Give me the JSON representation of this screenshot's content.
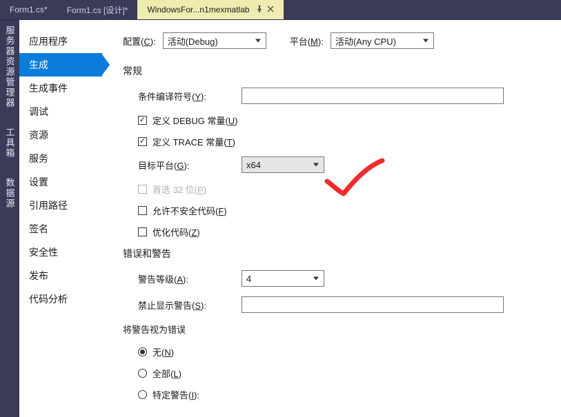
{
  "tabs": [
    {
      "label": "Form1.cs*"
    },
    {
      "label": "Form1.cs [设计]*"
    },
    {
      "label": "WindowsFor...n1mexmatlab"
    }
  ],
  "rail": {
    "items": [
      "服务器资源管理器",
      "工具箱",
      "数据源"
    ]
  },
  "sidebar": {
    "items": [
      "应用程序",
      "生成",
      "生成事件",
      "调试",
      "资源",
      "服务",
      "设置",
      "引用路径",
      "签名",
      "安全性",
      "发布",
      "代码分析"
    ],
    "selected": "生成"
  },
  "config": {
    "configLabelPrefix": "配置(",
    "configHotkey": "C",
    "configLabelSuffix": "):",
    "configValue": "活动(Debug)",
    "platformLabelPrefix": "平台(",
    "platformHotkey": "M",
    "platformLabelSuffix": "):",
    "platformValue": "活动(Any CPU)"
  },
  "general": {
    "header": "常规",
    "condSymbolsPrefix": "条件编译符号(",
    "condSymbolsHotkey": "Y",
    "condSymbolsSuffix": "):",
    "condSymbolsValue": "",
    "defineDebugPrefix": "定义 DEBUG 常量(",
    "defineDebugHotkey": "U",
    "defineDebugSuffix": ")",
    "defineTracePrefix": "定义 TRACE 常量(",
    "defineTraceHotkey": "T",
    "defineTraceSuffix": ")",
    "targetPlatformPrefix": "目标平台(",
    "targetPlatformHotkey": "G",
    "targetPlatformSuffix": "):",
    "targetPlatformValue": "x64",
    "prefer32Prefix": "首选 32 位(",
    "prefer32Hotkey": "P",
    "prefer32Suffix": ")",
    "allowUnsafePrefix": "允许不安全代码(",
    "allowUnsafeHotkey": "F",
    "allowUnsafeSuffix": ")",
    "optimizePrefix": "优化代码(",
    "optimizeHotkey": "Z",
    "optimizeSuffix": ")"
  },
  "errors": {
    "header": "错误和警告",
    "warnLevelPrefix": "警告等级(",
    "warnLevelHotkey": "A",
    "warnLevelSuffix": "):",
    "warnLevelValue": "4",
    "suppressPrefix": "禁止显示警告(",
    "suppressHotkey": "S",
    "suppressSuffix": "):",
    "suppressValue": "",
    "treatHeader": "将警告视为错误",
    "nonePrefix": "无(",
    "noneHotkey": "N",
    "noneSuffix": ")",
    "allPrefix": "全部(",
    "allHotkey": "L",
    "allSuffix": ")",
    "specificPrefix": "特定警告(",
    "specificHotkey": "I",
    "specificSuffix": "):"
  }
}
